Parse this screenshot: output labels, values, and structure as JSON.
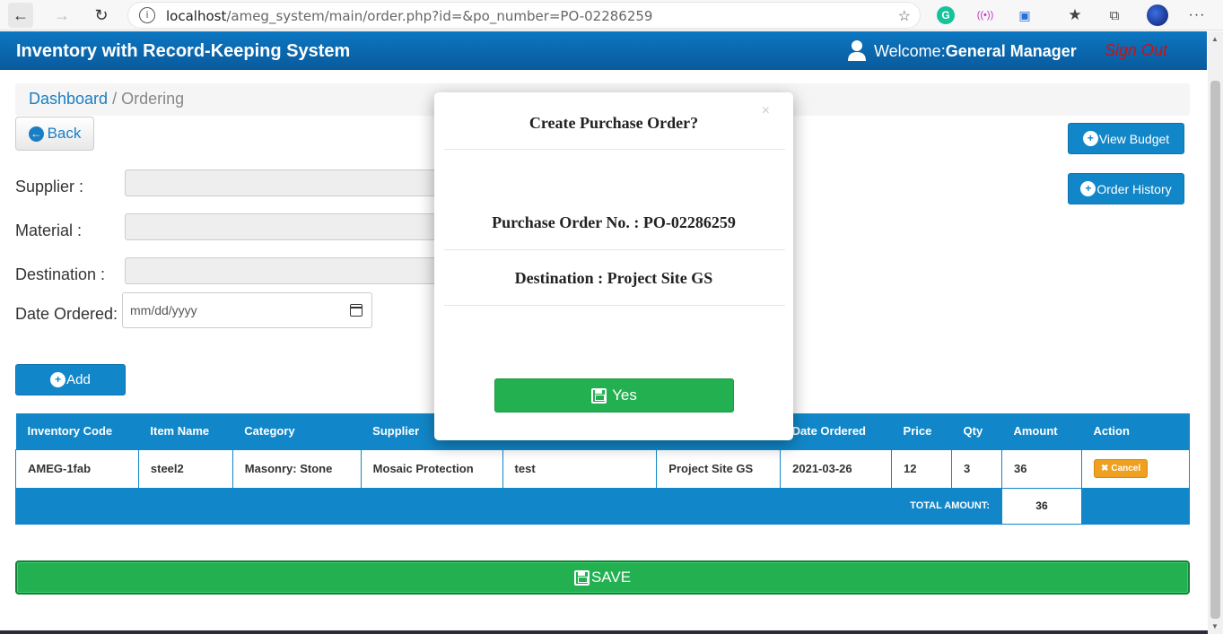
{
  "browser": {
    "url_host": "localhost",
    "url_path": "/ameg_system/main/order.php?id=&po_number=PO-02286259"
  },
  "header": {
    "title": "Inventory with Record-Keeping System",
    "welcome_prefix": "Welcome:",
    "user_role": "General Manager",
    "sign_out": "Sign Out"
  },
  "breadcrumb": {
    "home": "Dashboard",
    "separator": " / ",
    "current": "Ordering"
  },
  "back_button": "Back",
  "side_buttons": {
    "view_budget": "View Budget",
    "order_history": "Order History"
  },
  "form": {
    "supplier_label": "Supplier :",
    "material_label": "Material :",
    "destination_label": "Destination :",
    "date_label": "Date Ordered:",
    "date_placeholder": "mm/dd/yyyy"
  },
  "add_button": "Add",
  "table": {
    "headers": [
      "Inventory Code",
      "Item Name",
      "Category",
      "Supplier",
      "",
      "",
      "Date Ordered",
      "Price",
      "Qty",
      "Amount",
      "Action"
    ],
    "rows": [
      {
        "code": "AMEG-1fab",
        "item": "steel2",
        "category": "Masonry: Stone",
        "supplier": "Mosaic Protection",
        "col5": "test",
        "destination": "Project Site GS",
        "date": "2021-03-26",
        "price": "12",
        "qty": "3",
        "amount": "36",
        "action": "Cancel"
      }
    ],
    "total_label": "TOTAL AMOUNT:",
    "total_value": "36"
  },
  "save_button": "SAVE",
  "modal": {
    "title": "Create Purchase Order?",
    "close": "×",
    "po_line": "Purchase Order No. : PO-02286259",
    "destination_line": "Destination : Project Site GS",
    "yes_button": "Yes"
  },
  "colors": {
    "header_blue": "#0c77c2",
    "table_blue": "#1187c9",
    "save_green": "#22b050",
    "sign_out_red": "#d01010",
    "cancel_orange": "#f0a01f"
  }
}
